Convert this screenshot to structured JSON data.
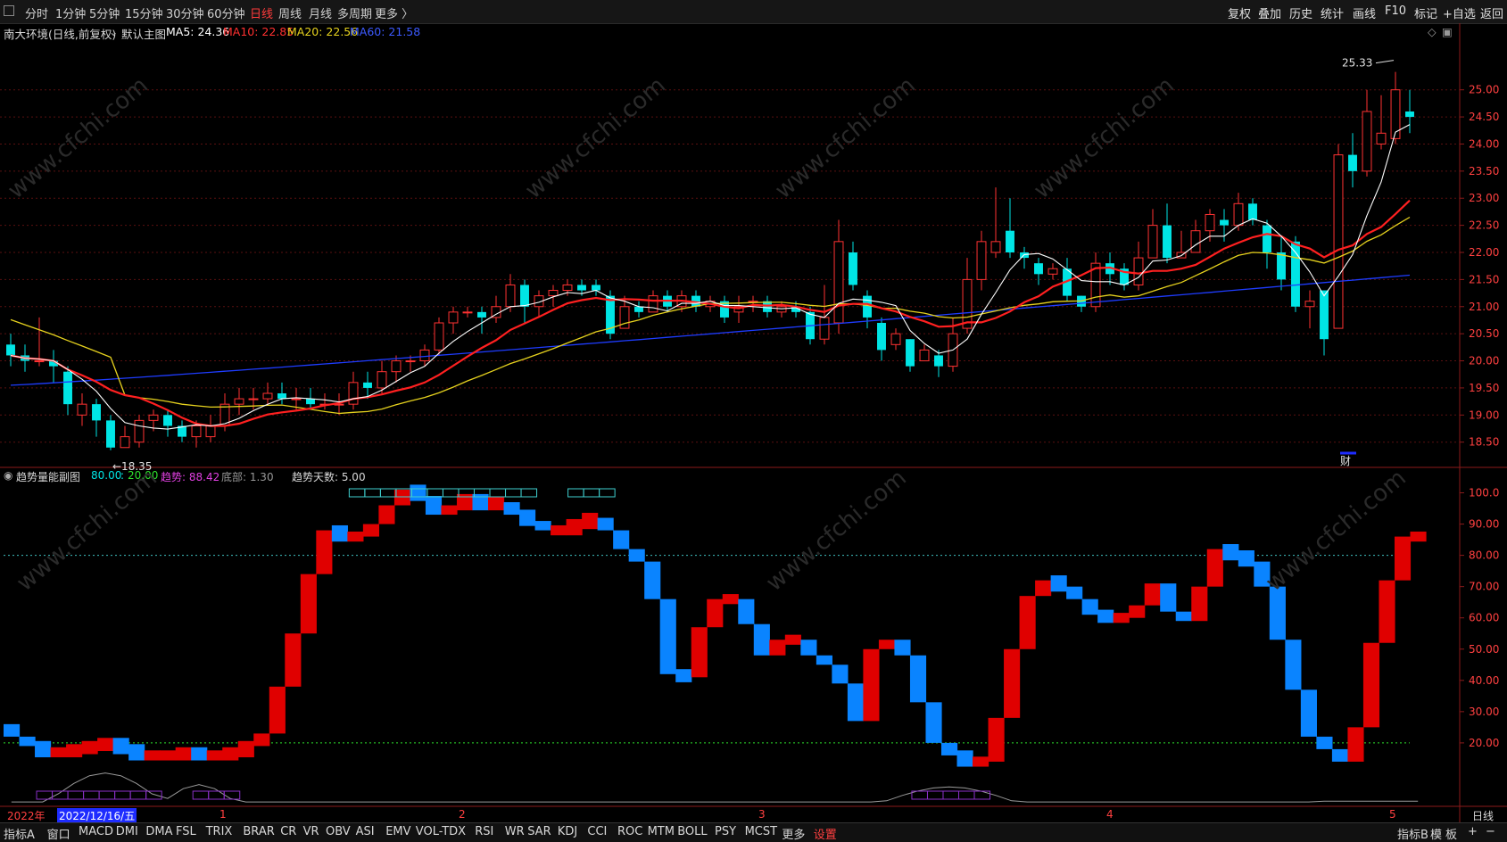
{
  "toolbar": {
    "periods": [
      "分时",
      "1分钟",
      "5分钟",
      "15分钟",
      "30分钟",
      "60分钟",
      "日线",
      "周线",
      "月线",
      "多周期",
      "更多 〉"
    ],
    "active_period": "日线",
    "right_buttons": [
      "复权",
      "叠加",
      "历史",
      "统计",
      "画线",
      "F10",
      "标记",
      "+自选",
      "返回"
    ]
  },
  "main_title": {
    "stock": "南大环境(日线,前复权)",
    "chart_label": "默认主图",
    "ma5": "MA5: 24.36",
    "ma10": "MA10: 22.85",
    "ma20": "MA20: 22.56",
    "ma60": "MA60: 21.58"
  },
  "sub_title": {
    "name": "趋势量能副图",
    "v1": "80.00",
    "sep": ":",
    "v2": "20.00",
    "trend": "趋势: 88.42",
    "bottom": "底部: 1.30",
    "days": "趋势天数: 5.00"
  },
  "annotations": {
    "high_label": "25.33",
    "low_label": "←18.35",
    "fin_mark": "财"
  },
  "date_axis": {
    "year": "2022年",
    "cursor_date": "2022/12/16/五",
    "months": [
      "1",
      "2",
      "3",
      "4",
      "5"
    ]
  },
  "period_right": "日线",
  "bottom_tabs": [
    "指标A",
    "窗口",
    "MACD",
    "DMI",
    "DMA",
    "FSL",
    "TRIX",
    "BRAR",
    "CR",
    "VR",
    "OBV",
    "ASI",
    "EMV",
    "VOL-TDX",
    "RSI",
    "WR",
    "SAR",
    "KDJ",
    "CCI",
    "ROC",
    "MTM",
    "BOLL",
    "PSY",
    "MCST",
    "更多",
    "设置"
  ],
  "bottom_right": [
    "指标B",
    "模",
    "板",
    "+",
    "−"
  ],
  "colors": {
    "up": "#ff3232",
    "down": "#00e5e5",
    "ma5": "#ffffff",
    "ma10": "#ff2020",
    "ma20": "#e6d21e",
    "ma60": "#1e3cff",
    "bar_up": "#e00000",
    "bar_down": "#0a84ff"
  },
  "chart_data": [
    {
      "type": "candlestick",
      "yaxis_ticks": [
        "25.00",
        "24.50",
        "24.00",
        "23.50",
        "23.00",
        "22.50",
        "22.00",
        "21.50",
        "21.00",
        "20.50",
        "20.00",
        "19.50",
        "19.00",
        "18.50"
      ],
      "ylim": [
        18.1,
        25.9
      ],
      "candles": [
        [
          20.3,
          20.1,
          20.5,
          19.9
        ],
        [
          20.1,
          20.0,
          20.3,
          19.8
        ],
        [
          20.0,
          20.0,
          20.8,
          19.9
        ],
        [
          20.0,
          19.9,
          20.2,
          19.6
        ],
        [
          19.8,
          19.2,
          19.9,
          19.0
        ],
        [
          19.0,
          19.2,
          19.4,
          18.8
        ],
        [
          19.2,
          18.9,
          19.3,
          18.6
        ],
        [
          18.9,
          18.4,
          19.0,
          18.35
        ],
        [
          18.4,
          18.6,
          18.8,
          18.4
        ],
        [
          18.5,
          18.9,
          19.0,
          18.4
        ],
        [
          18.9,
          19.0,
          19.1,
          18.7
        ],
        [
          19.0,
          18.8,
          19.1,
          18.6
        ],
        [
          18.8,
          18.6,
          18.9,
          18.5
        ],
        [
          18.6,
          18.8,
          18.9,
          18.4
        ],
        [
          18.6,
          18.8,
          19.0,
          18.5
        ],
        [
          18.8,
          19.2,
          19.4,
          18.7
        ],
        [
          19.2,
          19.3,
          19.5,
          19.0
        ],
        [
          19.3,
          19.3,
          19.5,
          19.1
        ],
        [
          19.3,
          19.4,
          19.6,
          19.2
        ],
        [
          19.4,
          19.3,
          19.6,
          19.2
        ],
        [
          19.3,
          19.3,
          19.5,
          19.1
        ],
        [
          19.3,
          19.2,
          19.5,
          19.1
        ],
        [
          19.2,
          19.2,
          19.4,
          19.1
        ],
        [
          19.2,
          19.2,
          19.4,
          19.0
        ],
        [
          19.2,
          19.6,
          19.8,
          19.1
        ],
        [
          19.6,
          19.5,
          19.8,
          19.3
        ],
        [
          19.5,
          19.8,
          20.0,
          19.4
        ],
        [
          19.8,
          20.0,
          20.1,
          19.6
        ],
        [
          20.0,
          20.0,
          20.1,
          19.8
        ],
        [
          20.0,
          20.2,
          20.3,
          19.9
        ],
        [
          20.2,
          20.7,
          20.8,
          20.1
        ],
        [
          20.7,
          20.9,
          21.0,
          20.5
        ],
        [
          20.9,
          20.9,
          21.0,
          20.8
        ],
        [
          20.9,
          20.8,
          21.0,
          20.5
        ],
        [
          20.8,
          21.0,
          21.2,
          20.7
        ],
        [
          21.0,
          21.4,
          21.6,
          20.9
        ],
        [
          21.4,
          21.0,
          21.5,
          20.7
        ],
        [
          21.0,
          21.2,
          21.3,
          20.8
        ],
        [
          21.2,
          21.3,
          21.4,
          21.0
        ],
        [
          21.3,
          21.4,
          21.5,
          21.2
        ],
        [
          21.4,
          21.3,
          21.5,
          21.2
        ],
        [
          21.4,
          21.3,
          21.5,
          21.2
        ],
        [
          21.2,
          20.5,
          21.3,
          20.4
        ],
        [
          20.6,
          21.0,
          21.2,
          20.6
        ],
        [
          21.0,
          20.9,
          21.1,
          20.8
        ],
        [
          20.9,
          21.2,
          21.3,
          20.9
        ],
        [
          21.2,
          21.0,
          21.3,
          20.9
        ],
        [
          21.0,
          21.2,
          21.3,
          20.9
        ],
        [
          21.2,
          21.0,
          21.3,
          20.9
        ],
        [
          21.0,
          21.1,
          21.2,
          20.9
        ],
        [
          21.1,
          20.8,
          21.2,
          20.7
        ],
        [
          20.9,
          21.0,
          21.2,
          20.7
        ],
        [
          21.1,
          21.1,
          21.2,
          20.9
        ],
        [
          21.1,
          20.9,
          21.2,
          20.8
        ],
        [
          20.9,
          21.0,
          21.1,
          20.8
        ],
        [
          21.0,
          20.9,
          21.1,
          20.8
        ],
        [
          20.9,
          20.4,
          21.0,
          20.3
        ],
        [
          20.4,
          20.8,
          21.4,
          20.3
        ],
        [
          20.7,
          22.2,
          22.6,
          20.5
        ],
        [
          22.0,
          21.4,
          22.2,
          21.3
        ],
        [
          21.2,
          20.8,
          21.3,
          20.6
        ],
        [
          20.7,
          20.2,
          20.8,
          20.0
        ],
        [
          20.3,
          20.5,
          20.6,
          20.2
        ],
        [
          20.4,
          19.9,
          20.4,
          19.8
        ],
        [
          20.0,
          20.2,
          20.3,
          20.0
        ],
        [
          20.1,
          19.9,
          20.2,
          19.7
        ],
        [
          19.9,
          20.5,
          20.8,
          19.8
        ],
        [
          20.6,
          21.5,
          21.9,
          20.5
        ],
        [
          21.5,
          22.2,
          22.4,
          21.3
        ],
        [
          22.0,
          22.2,
          23.2,
          21.9
        ],
        [
          22.4,
          22.0,
          23.0,
          21.9
        ],
        [
          22.0,
          21.9,
          22.1,
          21.7
        ],
        [
          21.8,
          21.6,
          21.9,
          21.4
        ],
        [
          21.6,
          21.7,
          21.8,
          21.5
        ],
        [
          21.7,
          21.2,
          21.9,
          21.1
        ],
        [
          21.2,
          21.0,
          21.2,
          20.9
        ],
        [
          21.0,
          21.8,
          22.0,
          20.9
        ],
        [
          21.8,
          21.6,
          22.0,
          21.4
        ],
        [
          21.7,
          21.4,
          21.8,
          21.3
        ],
        [
          21.4,
          21.9,
          22.2,
          21.3
        ],
        [
          21.9,
          22.5,
          22.8,
          21.9
        ],
        [
          22.5,
          21.9,
          22.9,
          21.8
        ],
        [
          21.9,
          22.0,
          22.4,
          21.9
        ],
        [
          22.0,
          22.4,
          22.6,
          22.0
        ],
        [
          22.4,
          22.7,
          22.8,
          22.2
        ],
        [
          22.6,
          22.5,
          22.8,
          22.2
        ],
        [
          22.5,
          22.9,
          23.1,
          22.4
        ],
        [
          22.9,
          22.6,
          23.0,
          22.5
        ],
        [
          22.5,
          22.0,
          22.6,
          21.7
        ],
        [
          22.0,
          21.5,
          22.3,
          21.3
        ],
        [
          22.2,
          21.0,
          22.3,
          20.9
        ],
        [
          21.0,
          21.1,
          21.3,
          20.6
        ],
        [
          21.3,
          20.4,
          21.3,
          20.1
        ],
        [
          20.6,
          23.8,
          24.0,
          20.6
        ],
        [
          23.8,
          23.5,
          24.2,
          23.2
        ],
        [
          23.5,
          24.6,
          25.0,
          23.4
        ],
        [
          24.0,
          24.2,
          24.9,
          23.9
        ],
        [
          24.1,
          25.0,
          25.33,
          24.0
        ],
        [
          24.6,
          24.5,
          25.0,
          24.2
        ]
      ],
      "ma_note": "MA5, MA10, MA20, MA60 overlays"
    },
    {
      "type": "bar",
      "name": "趋势量能副图",
      "yaxis_ticks": [
        "100.0",
        "90.00",
        "80.00",
        "70.00",
        "60.00",
        "50.00",
        "40.00",
        "30.00",
        "20.00"
      ],
      "ylim": [
        0,
        103
      ],
      "reference_lines": [
        80,
        20
      ],
      "trend_values": [
        22,
        19,
        17,
        17,
        18,
        19,
        20,
        18,
        16,
        16,
        16,
        17,
        16,
        16,
        17,
        19,
        23,
        38,
        55,
        74,
        88,
        86,
        86,
        90,
        96,
        101,
        99,
        93,
        96,
        98,
        96,
        97,
        93,
        91,
        88,
        88,
        90,
        92,
        88,
        82,
        78,
        66,
        42,
        41,
        57,
        66,
        66,
        58,
        48,
        53,
        53,
        48,
        45,
        39,
        27,
        50,
        53,
        48,
        33,
        20,
        16,
        14,
        14,
        28,
        50,
        67,
        72,
        70,
        66,
        61,
        60,
        60,
        64,
        71,
        62,
        59,
        70,
        82,
        80,
        78,
        70,
        53,
        37,
        22,
        18,
        14,
        25,
        52,
        72,
        86,
        86
      ]
    }
  ]
}
